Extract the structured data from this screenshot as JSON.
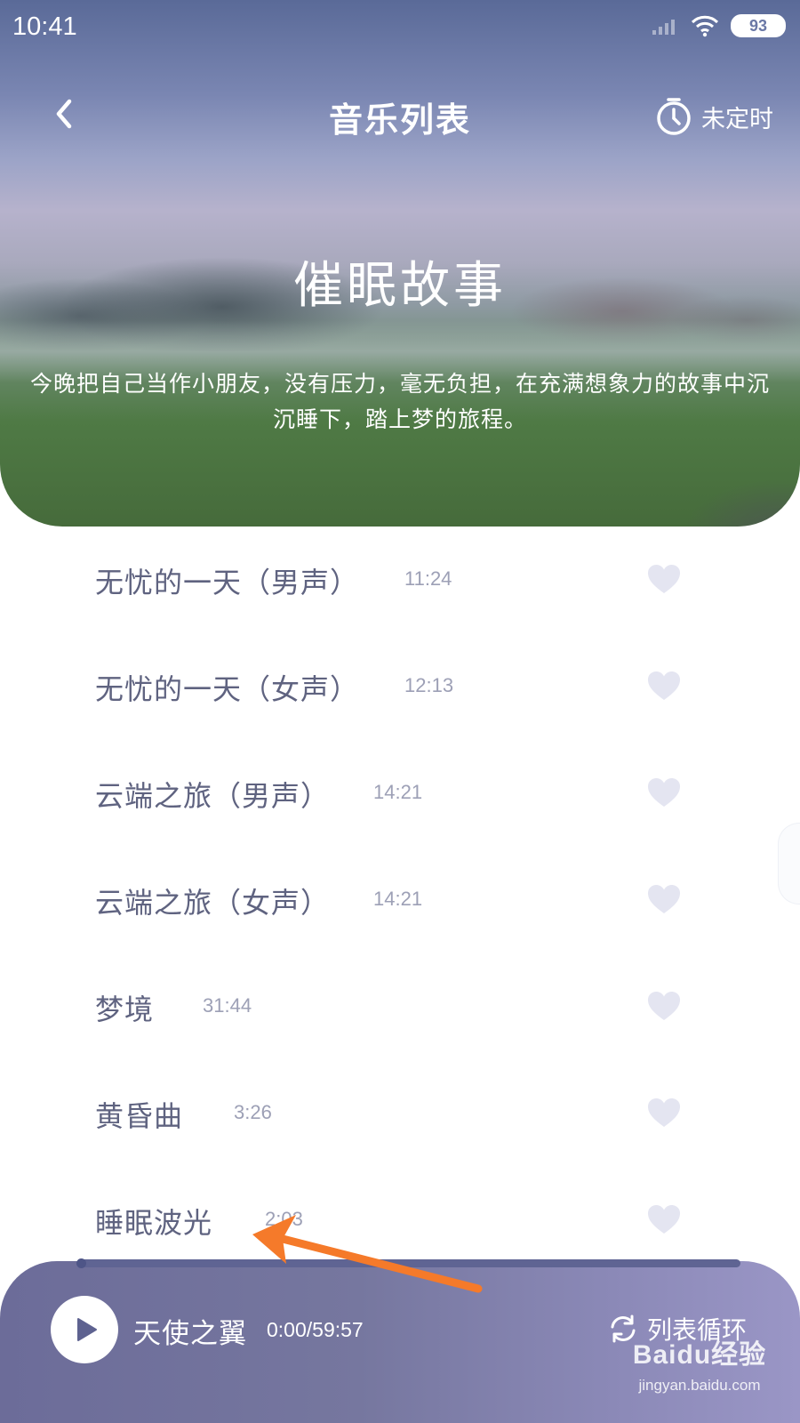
{
  "status_bar": {
    "time": "10:41",
    "battery": "93"
  },
  "header": {
    "title": "音乐列表",
    "timer_label": "未定时"
  },
  "album": {
    "title": "催眠故事",
    "description": "今晚把自己当作小朋友，没有压力，毫无负担，在充满想象力的故事中沉沉睡下，踏上梦的旅程。"
  },
  "tracks": [
    {
      "name": "无忧的一天（男声）",
      "duration": "11:24"
    },
    {
      "name": "无忧的一天（女声）",
      "duration": "12:13"
    },
    {
      "name": "云端之旅（男声）",
      "duration": "14:21"
    },
    {
      "name": "云端之旅（女声）",
      "duration": "14:21"
    },
    {
      "name": "梦境",
      "duration": "31:44"
    },
    {
      "name": "黄昏曲",
      "duration": "3:26"
    },
    {
      "name": "睡眠波光",
      "duration": "2:03"
    }
  ],
  "player": {
    "title": "天使之翼",
    "time": "0:00/59:57",
    "progress": 0,
    "loop_label": "列表循环"
  },
  "watermark": {
    "logo": "Baidu经验",
    "url": "jingyan.baidu.com"
  },
  "colors": {
    "accent": "#6c6c99",
    "track_text": "#5f6380",
    "duration_text": "#9da0b6",
    "heart": "#e4e5f1",
    "annotation_arrow": "#f57a2a"
  },
  "icons": [
    "signal-icon",
    "wifi-icon",
    "back-icon",
    "timer-icon",
    "heart-icon",
    "play-icon",
    "loop-icon"
  ]
}
